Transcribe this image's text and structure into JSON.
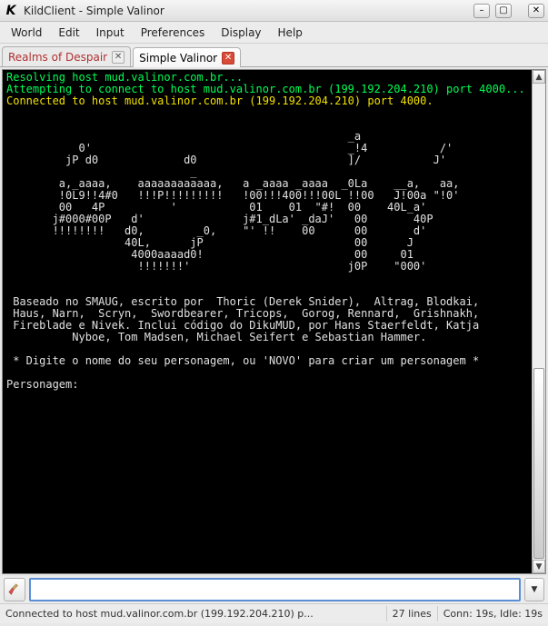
{
  "window": {
    "app_icon_glyph": "K",
    "title": "KildClient - Simple Valinor"
  },
  "menu": {
    "items": [
      "World",
      "Edit",
      "Input",
      "Preferences",
      "Display",
      "Help"
    ]
  },
  "tabs": [
    {
      "label": "Realms of Despair",
      "active": false
    },
    {
      "label": "Simple Valinor",
      "active": true
    }
  ],
  "terminal": {
    "lines": [
      {
        "cls": "g",
        "text": "Resolving host mud.valinor.com.br..."
      },
      {
        "cls": "g",
        "text": "Attempting to connect to host mud.valinor.com.br (199.192.204.210) port 4000..."
      },
      {
        "cls": "y",
        "text": "Connected to host mud.valinor.com.br (199.192.204.210) port 4000."
      },
      {
        "cls": "w",
        "text": ""
      },
      {
        "cls": "w",
        "text": ""
      },
      {
        "cls": "w",
        "text": "                                                    _a"
      },
      {
        "cls": "w",
        "text": "           0'                                       _!4           /'"
      },
      {
        "cls": "w",
        "text": "         jP d0             d0                       ]/           J'"
      },
      {
        "cls": "w",
        "text": "                            _"
      },
      {
        "cls": "w",
        "text": "        a,_aaaa,    aaaaaaaaaaaa,   a _aaaa _aaaa  _0La    __a,   aa,"
      },
      {
        "cls": "w",
        "text": "        !0L9!!4#0   !!!P!!!!!!!!!   !00!!!400!!!00L !!00   J!00a \"!0'"
      },
      {
        "cls": "w",
        "text": "        00   4P          '           01    01  \"#!  00    40L_a'"
      },
      {
        "cls": "w",
        "text": "       j#000#00P   d'               j#1_dLa' _daJ'   00       40P"
      },
      {
        "cls": "w",
        "text": "       !!!!!!!!   d0,        _0,    \"' !!    00      00       d'"
      },
      {
        "cls": "w",
        "text": "                  40L,      jP                       00      J"
      },
      {
        "cls": "w",
        "text": "                   4000aaaad0!                       00     01"
      },
      {
        "cls": "w",
        "text": "                    !!!!!!!'                        j0P    \"000'"
      },
      {
        "cls": "w",
        "text": ""
      },
      {
        "cls": "w",
        "text": ""
      },
      {
        "cls": "w",
        "text": " Baseado no SMAUG, escrito por  Thoric (Derek Snider),  Altrag, Blodkai,"
      },
      {
        "cls": "w",
        "text": " Haus, Narn,  Scryn,  Swordbearer, Tricops,  Gorog, Rennard,  Grishnakh,"
      },
      {
        "cls": "w",
        "text": " Fireblade e Nivek. Inclui código do DikuMUD, por Hans Staerfeldt, Katja"
      },
      {
        "cls": "w",
        "text": "          Nyboe, Tom Madsen, Michael Seifert e Sebastian Hammer."
      },
      {
        "cls": "w",
        "text": ""
      },
      {
        "cls": "w",
        "text": " * Digite o nome do seu personagem, ou 'NOVO' para criar um personagem *"
      },
      {
        "cls": "w",
        "text": ""
      },
      {
        "cls": "w",
        "text": "Personagem: "
      }
    ]
  },
  "command_input": {
    "value": "",
    "placeholder": ""
  },
  "status": {
    "connection": "Connected to host mud.valinor.com.br (199.192.204.210) p...",
    "lines": "27 lines",
    "timing": "Conn: 19s, Idle: 19s"
  }
}
